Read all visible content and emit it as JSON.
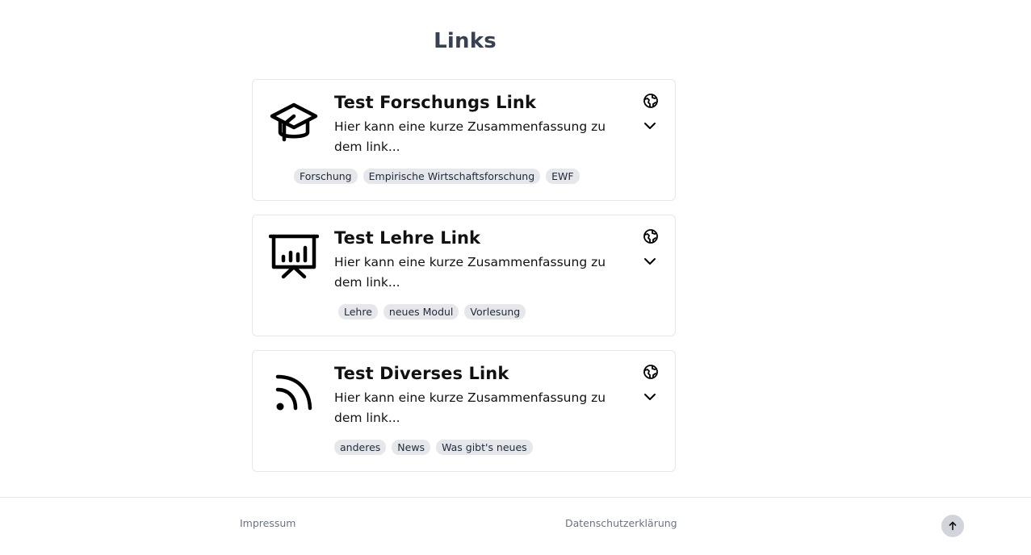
{
  "page": {
    "title": "Links"
  },
  "links": [
    {
      "title": "Test Forschungs Link",
      "summary": "Hier kann eine kurze Zusammenfassung zu dem link...",
      "icon": "graduation-cap-icon",
      "tags": [
        "Forschung",
        "Empirische Wirtschaftsforschung",
        "EWF"
      ]
    },
    {
      "title": "Test Lehre Link",
      "summary": "Hier kann eine kurze Zusammenfassung zu dem link...",
      "icon": "presentation-chart-icon",
      "tags": [
        "Lehre",
        "neues Modul",
        "Vorlesung"
      ]
    },
    {
      "title": "Test Diverses Link",
      "summary": "Hier kann eine kurze Zusammenfassung zu dem link...",
      "icon": "rss-icon",
      "tags": [
        "anderes",
        "News",
        "Was gibt's neues"
      ]
    }
  ],
  "footer": {
    "impressum": "Impressum",
    "datenschutz": "Datenschutzerklärung"
  },
  "colors": {
    "title": "#374151",
    "tag_bg": "#e5e7eb",
    "border": "#e5e7eb",
    "footer_text": "#6b7280",
    "scroll_button": "#d1d5db"
  }
}
